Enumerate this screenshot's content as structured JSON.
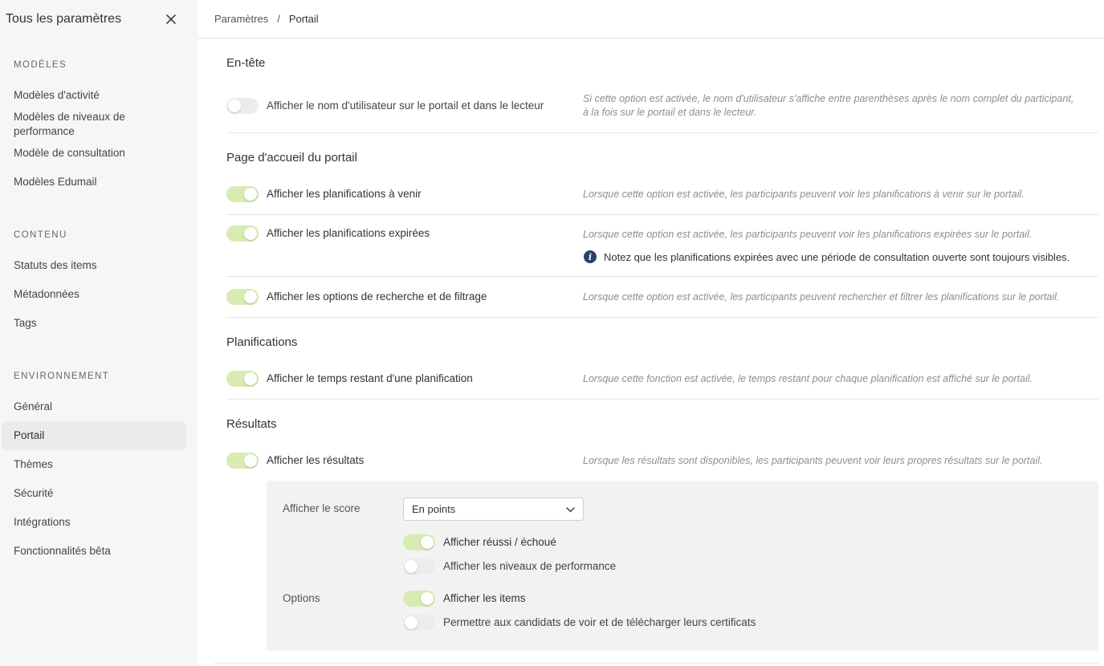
{
  "sidebar": {
    "title": "Tous les paramètres",
    "close_icon": "close-icon",
    "sections": [
      {
        "label": "MODÈLES",
        "items": [
          "Modèles d'activité",
          "Modèles de niveaux de performance",
          "Modèle de consultation",
          "Modèles Edumail"
        ]
      },
      {
        "label": "CONTENU",
        "items": [
          "Statuts des items",
          "Métadonnées",
          "Tags"
        ]
      },
      {
        "label": "ENVIRONNEMENT",
        "items": [
          "Général",
          "Portail",
          "Thèmes",
          "Sécurité",
          "Intégrations",
          "Fonctionnalités bêta"
        ]
      }
    ],
    "active_item": "Portail"
  },
  "breadcrumb": {
    "parent": "Paramètres",
    "separator": "/",
    "current": "Portail"
  },
  "sections": {
    "header": {
      "title": "En-tête",
      "rows": [
        {
          "label": "Afficher le nom d'utilisateur sur le portail et dans le lecteur",
          "enabled": false,
          "help_line1": "Si cette option est activée, le nom d'utilisateur s'affiche entre parenthèses après le nom complet du participant,",
          "help_line2": "à la fois sur le portail et dans le lecteur."
        }
      ]
    },
    "homepage": {
      "title": "Page d'accueil du portail",
      "rows": [
        {
          "label": "Afficher les planifications à venir",
          "enabled": true,
          "help": "Lorsque cette option est activée, les participants peuvent voir les planifications à venir sur le portail."
        },
        {
          "label": "Afficher les planifications expirées",
          "enabled": true,
          "help": "Lorsque cette option est activée, les participants peuvent voir les planifications expirées sur le portail.",
          "note": "Notez que les planifications expirées avec une période de consultation ouverte sont toujours visibles."
        },
        {
          "label": "Afficher les options de recherche et de filtrage",
          "enabled": true,
          "help": "Lorsque cette option est activée, les participants peuvent rechercher et filtrer les planifications sur le portail."
        }
      ]
    },
    "schedules": {
      "title": "Planifications",
      "rows": [
        {
          "label": "Afficher le temps restant d'une planification",
          "enabled": true,
          "help": "Lorsque cette fonction est activée, le temps restant pour chaque planification est affiché sur le portail."
        }
      ]
    },
    "results": {
      "title": "Résultats",
      "rows": [
        {
          "label": "Afficher les résultats",
          "enabled": true,
          "help": "Lorsque les résultats sont disponibles, les participants peuvent voir leurs propres résultats sur le portail."
        }
      ],
      "panel": {
        "score_label": "Afficher le score",
        "score_value": "En points",
        "options_label": "Options",
        "options": [
          {
            "label": "Afficher réussi / échoué",
            "enabled": true
          },
          {
            "label": "Afficher les niveaux de performance",
            "enabled": false
          },
          {
            "label": "Afficher les items",
            "enabled": true
          },
          {
            "label": "Permettre aux candidats de voir et de télécharger leurs certificats",
            "enabled": false
          }
        ]
      }
    }
  },
  "colors": {
    "toggle_on": "#d7ebb2",
    "toggle_off": "#ececec",
    "info_icon": "#2c3e6b",
    "sidebar_bg": "#f6f6f6",
    "panel_bg": "#f1f2f1"
  }
}
